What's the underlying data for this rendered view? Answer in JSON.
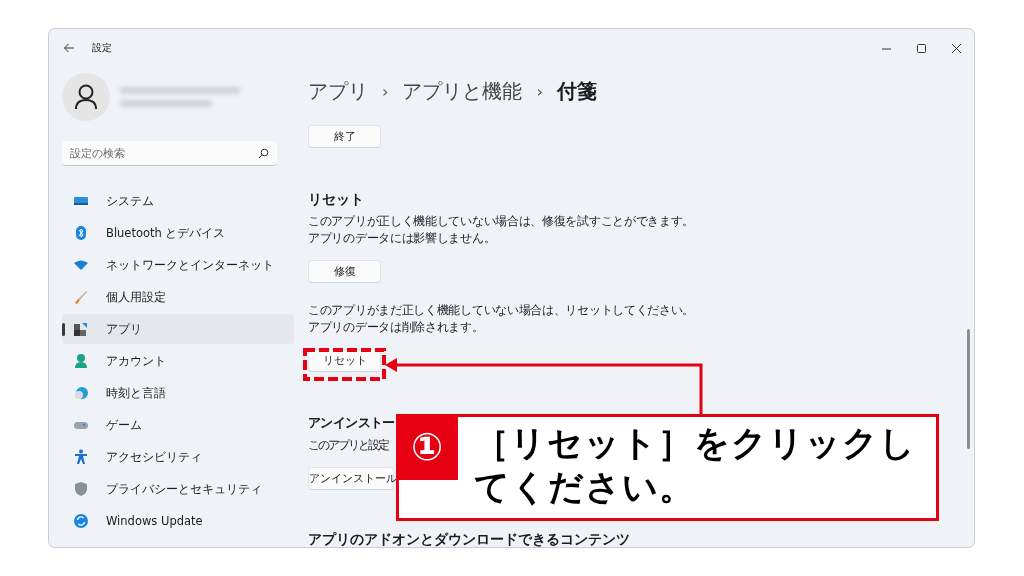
{
  "window": {
    "title": "設定"
  },
  "search": {
    "placeholder": "設定の検索"
  },
  "sidebar": {
    "items": [
      {
        "label": "システム",
        "selected": false
      },
      {
        "label": "Bluetooth とデバイス",
        "selected": false
      },
      {
        "label": "ネットワークとインターネット",
        "selected": false
      },
      {
        "label": "個人用設定",
        "selected": false
      },
      {
        "label": "アプリ",
        "selected": true
      },
      {
        "label": "アカウント",
        "selected": false
      },
      {
        "label": "時刻と言語",
        "selected": false
      },
      {
        "label": "ゲーム",
        "selected": false
      },
      {
        "label": "アクセシビリティ",
        "selected": false
      },
      {
        "label": "プライバシーとセキュリティ",
        "selected": false
      },
      {
        "label": "Windows Update",
        "selected": false
      }
    ]
  },
  "breadcrumb": {
    "items": [
      "アプリ",
      "アプリと機能",
      "付箋"
    ],
    "separator": "›"
  },
  "content": [
    {
      "kind": "button",
      "label": "終了"
    },
    {
      "kind": "heading",
      "text": "リセット"
    },
    {
      "kind": "text",
      "text": "このアプリが正しく機能していない場合は、修復を試すことができます。アプリのデータには影響しません。"
    },
    {
      "kind": "button",
      "label": "修復"
    },
    {
      "kind": "text",
      "text": "このアプリがまだ正しく機能していない場合は、リセットしてください。アプリのデータは削除されます。"
    },
    {
      "kind": "button",
      "label": "リセット",
      "highlighted": true
    },
    {
      "kind": "heading",
      "text": "アンインストー"
    },
    {
      "kind": "text",
      "text": "このアプリと設定"
    },
    {
      "kind": "button",
      "label": "アンインストール"
    },
    {
      "kind": "heading",
      "text": "アプリのアドオンとダウンロードできるコンテンツ"
    }
  ],
  "callout": {
    "number": "①",
    "text": "［リセット］をクリックしてください。"
  }
}
